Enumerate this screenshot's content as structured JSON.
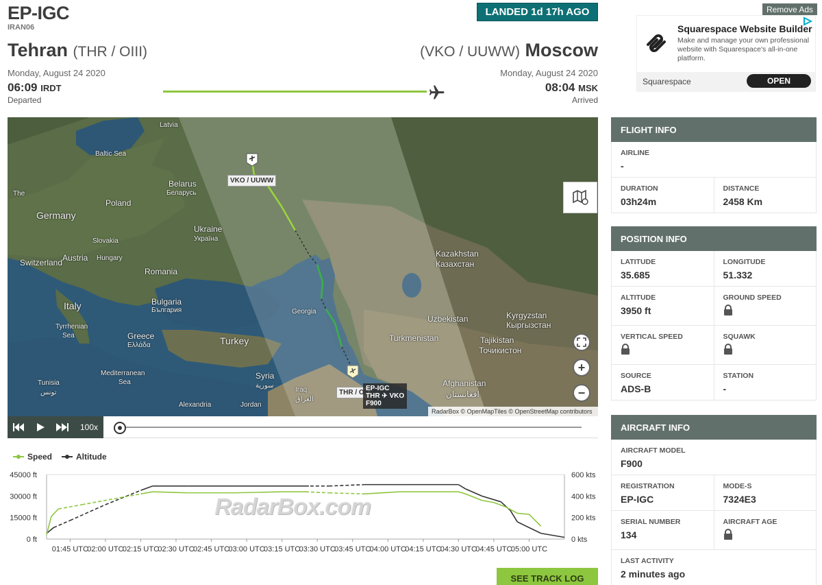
{
  "flight": {
    "registration": "EP-IGC",
    "callsign": "IRAN06",
    "status": "LANDED 1d 17h AGO"
  },
  "origin": {
    "city": "Tehran",
    "codes": "(THR / OIII)",
    "date": "Monday, August 24 2020",
    "time": "06:09",
    "tz": "IRDT",
    "label": "Departed"
  },
  "destination": {
    "city": "Moscow",
    "codes": "(VKO / UUWW)",
    "date": "Monday, August 24 2020",
    "time": "08:04",
    "tz": "MSK",
    "label": "Arrived"
  },
  "progress": 1.0,
  "ad": {
    "remove_label": "Remove Ads",
    "title": "Squarespace Website Builder",
    "description": "Make and manage your own professional website with Squarespace's all-in-one platform.",
    "brand": "Squarespace",
    "cta": "OPEN"
  },
  "map": {
    "labels": {
      "baltic": "Baltic Sea",
      "latvia": "Latvia",
      "belarus": "Belarus",
      "belarus_ru": "Беларусь",
      "poland": "Poland",
      "germany": "Germany",
      "ukraine": "Ukraine",
      "ukraine_ru": "Україна",
      "slovakia": "Slovakia",
      "hungary": "Hungary",
      "austria": "Austria",
      "switzerland": "Switzerland",
      "romania": "Romania",
      "italy": "Italy",
      "bulgaria": "Bulgaria",
      "bulgaria_ru": "България",
      "tyrrhenian": "Tyrrhenian",
      "tyrrhenian2": "Sea",
      "greece": "Greece",
      "greece_gr": "Ελλάδα",
      "turkey": "Turkey",
      "georgia": "Georgia",
      "mediterranean": "Mediterranean",
      "mediterranean2": "Sea",
      "tunisia": "Tunisia",
      "tunisia_ar": "تونس",
      "syria": "Syria",
      "syria_ar": "سورية",
      "iraq": "Iraq",
      "iraq_ar": "العراق",
      "jordan": "Jordan",
      "alexandria": "Alexandria",
      "kazakhstan": "Kazakhstan",
      "kazakhstan_ru": "Казахстан",
      "uzbekistan": "Uzbekistan",
      "kyrgyzstan": "Kyrgyzstan",
      "kyrgyzstan_ru": "Кыргызстан",
      "turkmenistan": "Turkmenistan",
      "tajikistan": "Tajikistan",
      "tajikistan_ru": "Точикистон",
      "afghanistan": "Afghanistan",
      "afghanistan_ar": "افغانستان",
      "the": "The"
    },
    "dest_tag": "VKO / UUWW",
    "origin_tag": "THR / OII",
    "flight_tag": {
      "reg": "EP-IGC",
      "route": "THR ✈ VKO",
      "type": "F900"
    },
    "attribution": "RadarBox © OpenMapTiles © OpenStreetMap contributors"
  },
  "playback": {
    "speed": "100x"
  },
  "chart_data": {
    "type": "line",
    "legend": [
      "Speed",
      "Altitude"
    ],
    "x_ticks": [
      "01:45 UTC",
      "02:00 UTC",
      "02:15 UTC",
      "02:30 UTC",
      "02:45 UTC",
      "03:00 UTC",
      "03:15 UTC",
      "03:30 UTC",
      "03:45 UTC",
      "04:00 UTC",
      "04:15 UTC",
      "04:30 UTC",
      "04:45 UTC",
      "05:00 UTC"
    ],
    "y_left_ticks": [
      "45000 ft",
      "30000 ft",
      "15000 ft",
      "0 ft"
    ],
    "y_right_ticks": [
      "600 kts",
      "400 kts",
      "200 kts",
      "0 kts"
    ],
    "ylim_left": [
      0,
      45000
    ],
    "ylim_right": [
      0,
      600
    ],
    "series": [
      {
        "name": "Altitude",
        "color": "#333333",
        "x_minutes_after_0135": [
          0,
          3,
          10,
          25,
          40,
          45,
          60,
          80,
          110,
          112,
          120,
          135,
          150,
          175,
          178,
          185,
          193,
          197,
          200,
          210,
          220
        ],
        "y": [
          3950,
          8000,
          13000,
          24000,
          34000,
          37000,
          37000,
          37000,
          37000,
          37000,
          37000,
          38000,
          38000,
          38000,
          35000,
          30000,
          26000,
          20000,
          12000,
          4000,
          1200
        ],
        "dashed_ranges": [
          [
            3,
            40
          ],
          [
            110,
            135
          ]
        ]
      },
      {
        "name": "Speed",
        "color": "#8dc63f",
        "x_minutes_after_0135": [
          0,
          2,
          5,
          15,
          40,
          45,
          60,
          80,
          100,
          110,
          120,
          135,
          150,
          175,
          178,
          185,
          190,
          195,
          200,
          205,
          210
        ],
        "y": [
          40,
          210,
          280,
          320,
          420,
          440,
          430,
          430,
          440,
          440,
          430,
          420,
          440,
          440,
          420,
          360,
          340,
          300,
          240,
          230,
          120
        ],
        "dashed_ranges": [
          [
            5,
            40
          ],
          [
            110,
            135
          ]
        ]
      }
    ]
  },
  "watermark": "RadarBox.com",
  "track_log_label": "SEE TRACK LOG",
  "sidebar": {
    "flight_info": {
      "title": "FLIGHT INFO",
      "airline_label": "AIRLINE",
      "airline": "-",
      "duration_label": "DURATION",
      "duration": "03h24m",
      "distance_label": "DISTANCE",
      "distance": "2458 Km"
    },
    "position_info": {
      "title": "POSITION INFO",
      "lat_label": "LATITUDE",
      "lat": "35.685",
      "lon_label": "LONGITUDE",
      "lon": "51.332",
      "alt_label": "ALTITUDE",
      "alt": "3950 ft",
      "gs_label": "GROUND SPEED",
      "vs_label": "VERTICAL SPEED",
      "squawk_label": "SQUAWK",
      "source_label": "SOURCE",
      "source": "ADS-B",
      "station_label": "STATION",
      "station": "-"
    },
    "aircraft_info": {
      "title": "AIRCRAFT INFO",
      "model_label": "AIRCRAFT MODEL",
      "model": "F900",
      "reg_label": "REGISTRATION",
      "reg": "EP-IGC",
      "modes_label": "MODE-S",
      "modes": "7324E3",
      "serial_label": "SERIAL NUMBER",
      "serial": "134",
      "age_label": "AIRCRAFT AGE",
      "activity_label": "LAST ACTIVITY",
      "activity": "2 minutes ago"
    }
  },
  "colors": {
    "accent_green": "#8dc63f",
    "status_teal": "#0e7074",
    "panel_header": "#62706c"
  }
}
